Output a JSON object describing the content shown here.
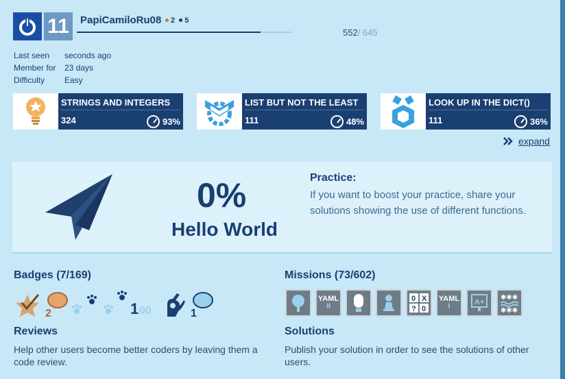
{
  "profile": {
    "username": "PapiCamiloRu08",
    "level": "11",
    "badge_counts": {
      "bronze": "2",
      "silver": "5"
    },
    "xp_current": "552",
    "xp_max": "/ 645",
    "xp_progress": 0.855,
    "info": [
      {
        "label": "Last seen",
        "value": "seconds ago"
      },
      {
        "label": "Member for",
        "value": "23 days"
      },
      {
        "label": "Difficulty",
        "value": "Easy"
      }
    ]
  },
  "categories": [
    {
      "title": "STRINGS AND INTEGERS",
      "count": "324",
      "percent": "93%",
      "icon": "lightbulb-icon"
    },
    {
      "title": "LIST BUT NOT THE LEAST",
      "count": "111",
      "percent": "48%",
      "icon": "gear-chevron-icon"
    },
    {
      "title": "LOOK UP IN THE DICT()",
      "count": "111",
      "percent": "36%",
      "icon": "cube-icon"
    }
  ],
  "expand_label": "expand",
  "hero": {
    "percent": "0%",
    "subtitle": "Hello World",
    "practice_title": "Practice:",
    "practice_text": "If you want to boost your practice, share your solutions showing the use of different functions."
  },
  "badges": {
    "title": "Badges (7/169)"
  },
  "missions": {
    "title": "Missions (73/602)",
    "items": [
      {
        "icon": "tree-icon",
        "label": ""
      },
      {
        "icon": "yaml-icon",
        "label": "YAML"
      },
      {
        "icon": "bulb-icon",
        "label": ""
      },
      {
        "icon": "chess-pawn-icon",
        "label": ""
      },
      {
        "icon": "tic-tac-toe-icon",
        "label": ""
      },
      {
        "icon": "yaml-icon",
        "label": "YAML"
      },
      {
        "icon": "grade-icon",
        "label": ""
      },
      {
        "icon": "stars-waves-icon",
        "label": ""
      }
    ]
  },
  "reviews": {
    "title": "Reviews",
    "text": "Help other users become better coders by leaving them a code review."
  },
  "solutions": {
    "title": "Solutions",
    "text": "Publish your solution in order to see the solutions of other users."
  },
  "colors": {
    "navy": "#1a3f71",
    "accent": "#1a4ea5",
    "panel": "#c8e7f7"
  }
}
